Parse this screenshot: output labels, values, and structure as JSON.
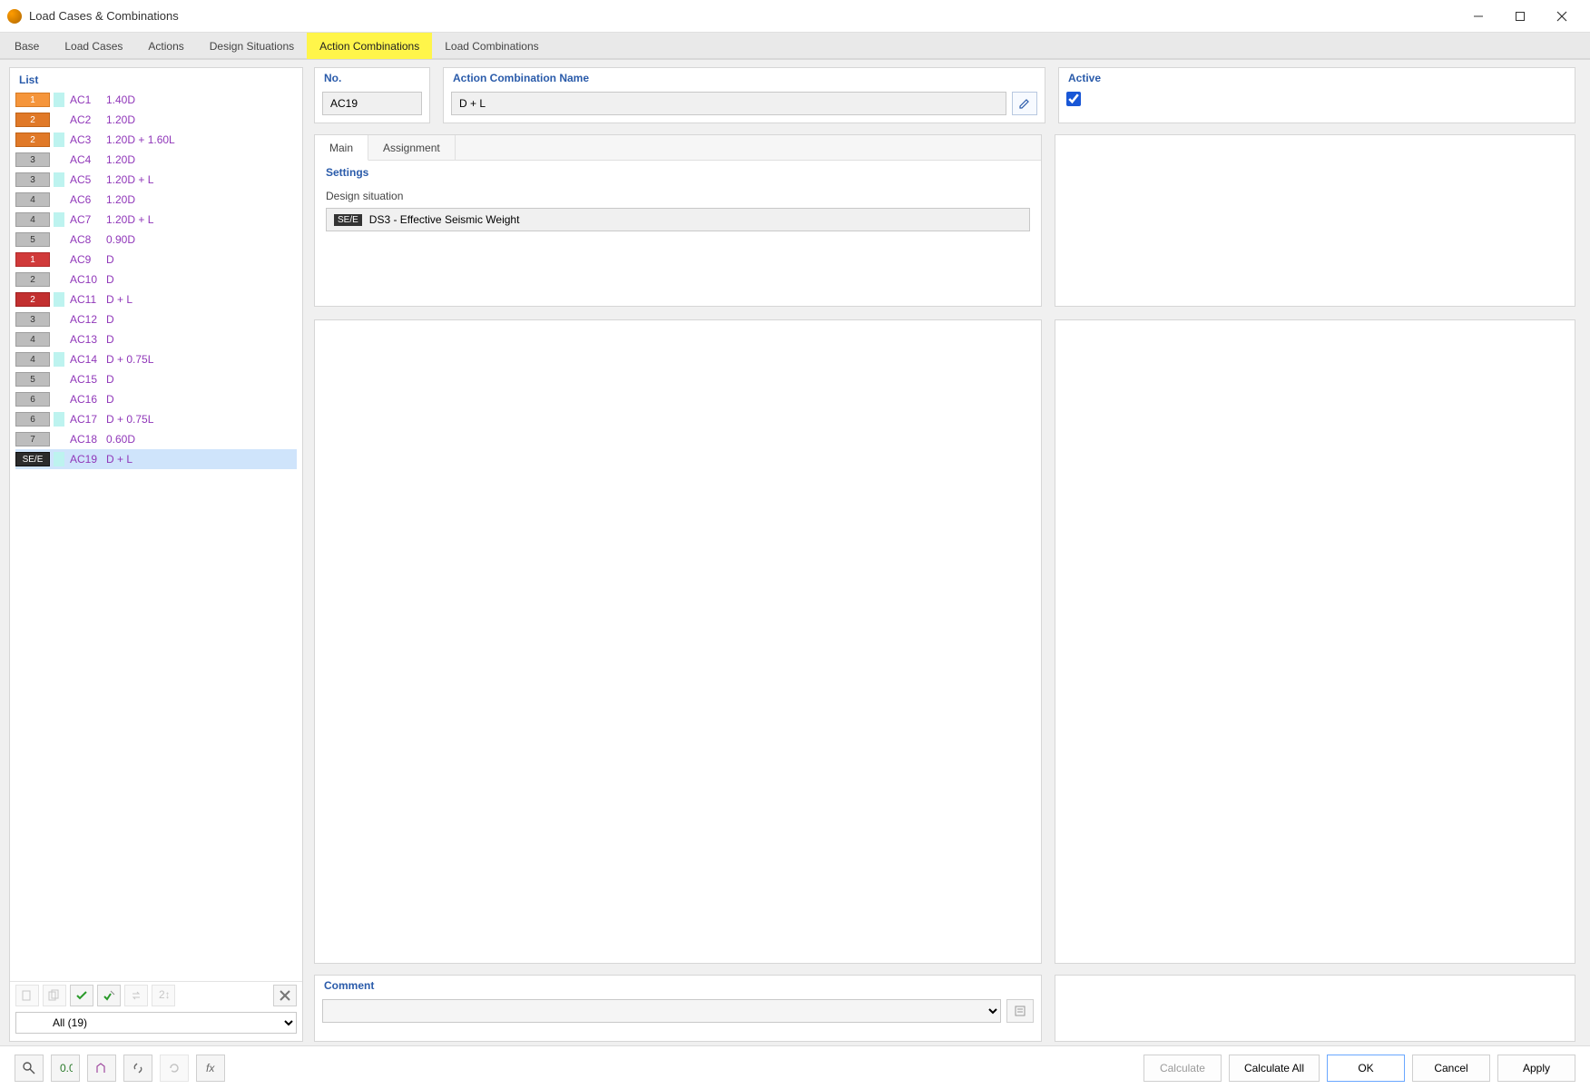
{
  "window": {
    "title": "Load Cases & Combinations"
  },
  "tabs": [
    {
      "label": "Base"
    },
    {
      "label": "Load Cases"
    },
    {
      "label": "Actions"
    },
    {
      "label": "Design Situations"
    },
    {
      "label": "Action Combinations",
      "active": true
    },
    {
      "label": "Load Combinations"
    }
  ],
  "left": {
    "header": "List",
    "filter_label": "All (19)",
    "rows": [
      {
        "badge": "1",
        "badge_cls": "bg-orange1",
        "chip": "chip-cyan",
        "ac": "AC1",
        "desc": "1.40D"
      },
      {
        "badge": "2",
        "badge_cls": "bg-orange2",
        "chip": "chip-none",
        "ac": "AC2",
        "desc": "1.20D"
      },
      {
        "badge": "2",
        "badge_cls": "bg-orange2",
        "chip": "chip-cyan",
        "ac": "AC3",
        "desc": "1.20D + 1.60L"
      },
      {
        "badge": "3",
        "badge_cls": "bg-gray",
        "chip": "chip-none",
        "ac": "AC4",
        "desc": "1.20D"
      },
      {
        "badge": "3",
        "badge_cls": "bg-gray",
        "chip": "chip-cyan",
        "ac": "AC5",
        "desc": "1.20D + L"
      },
      {
        "badge": "4",
        "badge_cls": "bg-gray",
        "chip": "chip-none",
        "ac": "AC6",
        "desc": "1.20D"
      },
      {
        "badge": "4",
        "badge_cls": "bg-gray",
        "chip": "chip-cyan",
        "ac": "AC7",
        "desc": "1.20D + L"
      },
      {
        "badge": "5",
        "badge_cls": "bg-gray",
        "chip": "chip-none",
        "ac": "AC8",
        "desc": "0.90D"
      },
      {
        "badge": "1",
        "badge_cls": "bg-red",
        "chip": "chip-none",
        "ac": "AC9",
        "desc": "D"
      },
      {
        "badge": "2",
        "badge_cls": "bg-gray",
        "chip": "chip-none",
        "ac": "AC10",
        "desc": "D"
      },
      {
        "badge": "2",
        "badge_cls": "bg-red2",
        "chip": "chip-cyan",
        "ac": "AC11",
        "desc": "D + L"
      },
      {
        "badge": "3",
        "badge_cls": "bg-gray",
        "chip": "chip-none",
        "ac": "AC12",
        "desc": "D"
      },
      {
        "badge": "4",
        "badge_cls": "bg-gray",
        "chip": "chip-none",
        "ac": "AC13",
        "desc": "D"
      },
      {
        "badge": "4",
        "badge_cls": "bg-gray",
        "chip": "chip-cyan",
        "ac": "AC14",
        "desc": "D + 0.75L"
      },
      {
        "badge": "5",
        "badge_cls": "bg-gray",
        "chip": "chip-none",
        "ac": "AC15",
        "desc": "D"
      },
      {
        "badge": "6",
        "badge_cls": "bg-gray",
        "chip": "chip-none",
        "ac": "AC16",
        "desc": "D"
      },
      {
        "badge": "6",
        "badge_cls": "bg-gray",
        "chip": "chip-cyan",
        "ac": "AC17",
        "desc": "D + 0.75L"
      },
      {
        "badge": "7",
        "badge_cls": "bg-gray",
        "chip": "chip-none",
        "ac": "AC18",
        "desc": "0.60D"
      },
      {
        "badge": "SE/E",
        "badge_cls": "bg-dark",
        "chip": "chip-cyan",
        "ac": "AC19",
        "desc": "D + L",
        "selected": true
      }
    ]
  },
  "form": {
    "no_label": "No.",
    "no_value": "AC19",
    "name_label": "Action Combination Name",
    "name_value": "D + L",
    "active_label": "Active",
    "active_checked": true,
    "subtabs": {
      "main": "Main",
      "assignment": "Assignment"
    },
    "settings_header": "Settings",
    "ds_label": "Design situation",
    "ds_pill": "SE/E",
    "ds_value": "DS3 - Effective Seismic Weight",
    "comment_label": "Comment"
  },
  "footer": {
    "calculate": "Calculate",
    "calculate_all": "Calculate All",
    "ok": "OK",
    "cancel": "Cancel",
    "apply": "Apply"
  }
}
